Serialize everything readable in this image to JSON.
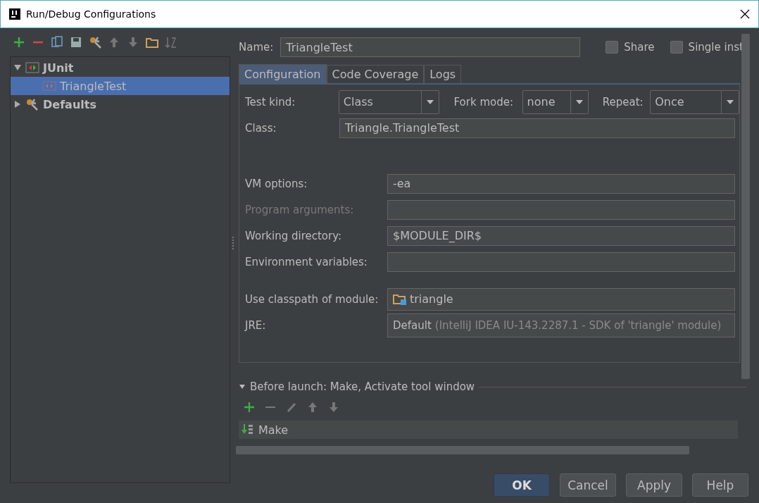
{
  "window": {
    "title": "Run/Debug Configurations"
  },
  "tree": [
    {
      "label": "JUnit",
      "kind": "junit",
      "expanded": true,
      "selected": false,
      "children": [
        {
          "label": "TriangleTest",
          "kind": "test",
          "selected": true
        }
      ]
    },
    {
      "label": "Defaults",
      "kind": "defaults",
      "expanded": false,
      "selected": false
    }
  ],
  "name_field": {
    "label": "Name:",
    "value": "TriangleTest"
  },
  "checkboxes": [
    {
      "label": "Share",
      "checked": false
    },
    {
      "label": "Single inst",
      "checked": false
    }
  ],
  "tabs": [
    {
      "label": "Configuration",
      "selected": true
    },
    {
      "label": "Code Coverage",
      "selected": false
    },
    {
      "label": "Logs",
      "selected": false
    }
  ],
  "combos": [
    {
      "label": "Test kind:",
      "value": "Class"
    },
    {
      "label": "Fork mode:",
      "value": "none"
    },
    {
      "label": "Repeat:",
      "value": "Once"
    }
  ],
  "class_field": {
    "label": "Class:",
    "value": "Triangle.TriangleTest"
  },
  "fields": [
    {
      "label": "VM options:",
      "value": "-ea",
      "disabled": false
    },
    {
      "label": "Program arguments:",
      "disabled": true
    },
    {
      "label": "Working directory:",
      "value": "$MODULE_DIR$",
      "disabled": false
    },
    {
      "label": "Environment variables:",
      "disabled": false
    }
  ],
  "module": {
    "label": "Use classpath of module:",
    "value": "triangle"
  },
  "jre": {
    "label": "JRE:",
    "value": "Default",
    "hint": "(IntelliJ IDEA IU-143.2287.1 - SDK of 'triangle' module)"
  },
  "before_launch": {
    "label": "Before launch: Make, Activate tool window",
    "expanded": true,
    "items": [
      "Make"
    ]
  },
  "buttons": [
    {
      "label": "OK",
      "kind": "default"
    },
    {
      "label": "Cancel",
      "kind": "normal"
    },
    {
      "label": "Apply",
      "kind": "normal"
    },
    {
      "label": "Help",
      "kind": "normal"
    }
  ]
}
